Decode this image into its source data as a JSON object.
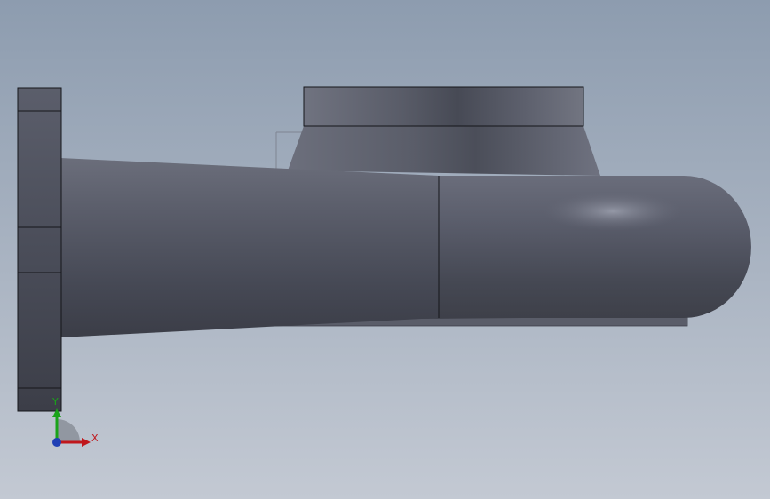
{
  "viewport": {
    "background": {
      "top": "#8d9caf",
      "bottom": "#c3c9d3"
    },
    "model": {
      "body_color": "#5c5f6c",
      "edge_color": "#15161a"
    }
  },
  "triad": {
    "x_label": "X",
    "y_label": "Y",
    "x_color": "#c0171c",
    "y_color": "#1aa31a",
    "z_color": "#1f3fb5",
    "arc_color": "#8a8f99"
  }
}
